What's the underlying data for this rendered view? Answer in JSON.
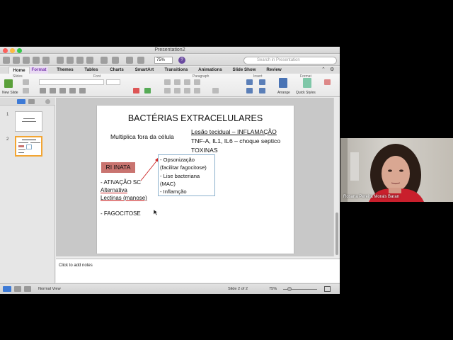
{
  "window": {
    "title": "Presentation2"
  },
  "toolbar": {
    "zoom": "75%",
    "search_placeholder": "Search in Presentation"
  },
  "ribbon_tabs": [
    "Home",
    "Format",
    "Themes",
    "Tables",
    "Charts",
    "SmartArt",
    "Transitions",
    "Animations",
    "Slide Show",
    "Review"
  ],
  "ribbon_groups": {
    "slides": "Slides",
    "font": "Font",
    "paragraph": "Paragraph",
    "insert": "Insert",
    "format": "Format"
  },
  "ribbon_buttons": {
    "new_slide": "New Slide",
    "arrange": "Arrange",
    "quick_styles": "Quick Styles"
  },
  "thumbnails": [
    {
      "number": "1",
      "selected": false
    },
    {
      "number": "2",
      "selected": true
    }
  ],
  "slide": {
    "title": "BACTÉRIAS EXTRACELULARES",
    "left_heading": "Multiplica fora da célula",
    "right_line1": "Lesão tecidual – INFLAMAÇÃO",
    "right_line2": "TNF-A, IL1, IL6 – choque septico",
    "right_line3": "TOXINAS",
    "box_label": "RI INATA",
    "bullet1_line1": "-   ATIVAÇÃO SC",
    "bullet1_line2": "Alternativa",
    "bullet1_line3": "Lectinas (manose)",
    "bullet2": "-   FAGOCITOSE",
    "callout": [
      "-    Opsonização",
      "(facilitar fagocitose)",
      "-    Lise bacteriana",
      "(MAC)",
      "- Inflamção"
    ]
  },
  "notes": {
    "placeholder": "Click to add notes"
  },
  "status": {
    "view": "Normal View",
    "slide_counter": "Slide 2 of 2",
    "zoom": "75%"
  },
  "webcam": {
    "participant_name": "Rosana Pereira Morais Baran"
  },
  "colors": {
    "format_tab": "#7a3ab0",
    "ri_box": "#c97470",
    "selected_thumb": "#f3a532",
    "callout_border": "#8bb0cc"
  }
}
